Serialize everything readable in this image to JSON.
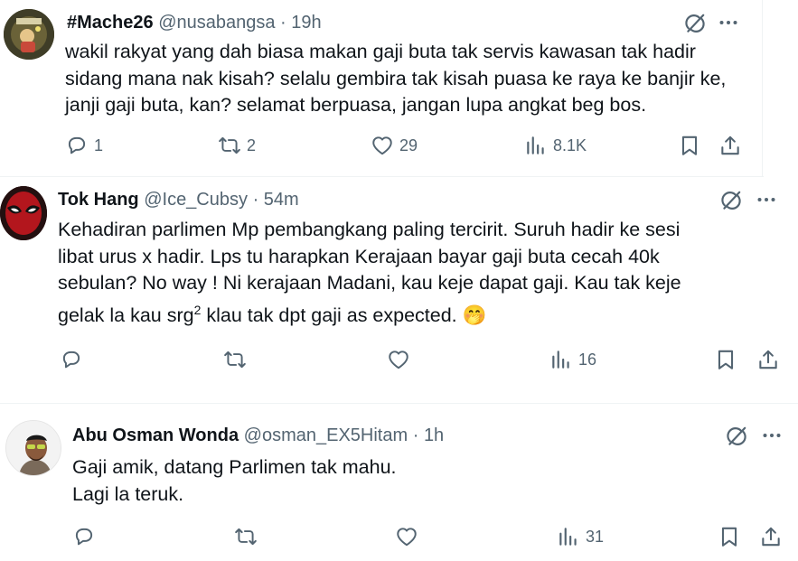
{
  "tweets": [
    {
      "name": "#Mache26",
      "handle": "@nusabangsa",
      "dot": "·",
      "time": "19h",
      "lines": [
        "wakil rakyat yang dah biasa makan gaji buta tak servis kawasan tak hadir",
        "sidang mana nak kisah? selalu gembira tak kisah puasa ke raya ke banjir ke,",
        "janji gaji buta, kan? selamat berpuasa, jangan lupa angkat beg bos."
      ],
      "replies": "1",
      "reposts": "2",
      "likes": "29",
      "views": "8.1K",
      "avatar_icon": "avatar-badge-icon"
    },
    {
      "name": "Tok Hang",
      "handle": "@Ice_Cubsy",
      "dot": "·",
      "time": "54m",
      "lines": [
        "Kehadiran parlimen Mp pembangkang paling tercirit. Suruh hadir ke sesi",
        "libat urus x hadir. Lps tu harapkan Kerajaan bayar gaji buta cecah 40k",
        "sebulan? No way ! Ni kerajaan Madani, kau keje dapat gaji. Kau tak keje"
      ],
      "last_line_pre": "gelak la kau srg",
      "last_line_sup": "2",
      "last_line_post": " klau tak dpt gaji as expected.",
      "emoji": "🤭",
      "replies": "",
      "reposts": "",
      "likes": "",
      "views": "16",
      "avatar_icon": "masked-hero-icon"
    },
    {
      "name": "Abu Osman Wonda",
      "handle": "@osman_EX5Hitam",
      "dot": "·",
      "time": "1h",
      "lines": [
        "Gaji amik, datang Parlimen tak mahu.",
        "Lagi la teruk."
      ],
      "replies": "",
      "reposts": "",
      "likes": "",
      "views": "31",
      "avatar_icon": "man-sunglasses-icon"
    }
  ],
  "colors": {
    "text": "#0f1419",
    "secondary": "#536471",
    "divider": "#eff3f4",
    "background": "#ffffff"
  },
  "icons": [
    "grok-icon",
    "more-icon",
    "reply-icon",
    "repost-icon",
    "like-icon",
    "views-icon",
    "bookmark-icon",
    "share-icon"
  ]
}
